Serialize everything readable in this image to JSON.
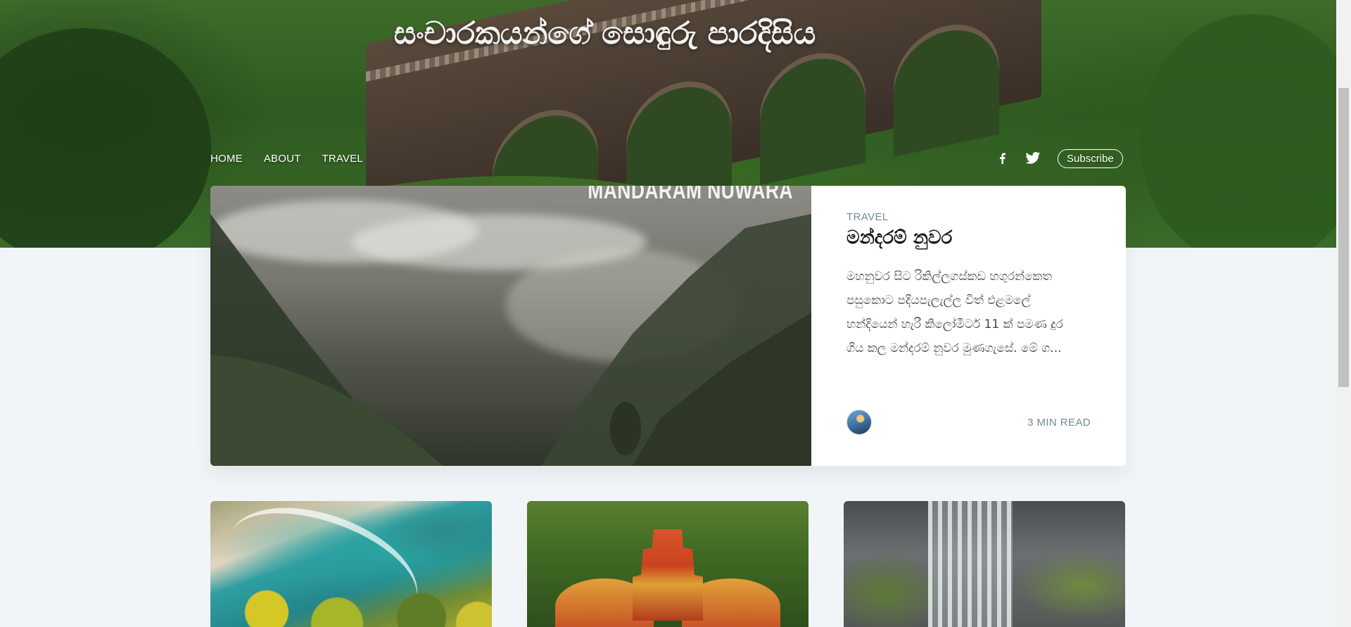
{
  "hero": {
    "title": "සංචාරකයන්ගේ සොඳුරු පාරදිසිය"
  },
  "nav": {
    "items": [
      {
        "label": "HOME"
      },
      {
        "label": "ABOUT"
      },
      {
        "label": "TRAVEL"
      }
    ],
    "social": [
      "facebook-icon",
      "twitter-icon"
    ],
    "subscribe_label": "Subscribe"
  },
  "featured": {
    "image_text": "MANDARAM NUWARA",
    "tag": "TRAVEL",
    "title": "මන්දරම් නුවර",
    "excerpt": "මහනුවර සිට රිකිල්ලගස්කඩ හගුරන්කෙත පසුකොට පදියපැලැල්ල විත් එළමලේ හන්දියෙන් හැරී කිලෝමීටර් 11 ක් පමණ දුර ගිය කල මන්දරම් නුවර මුණගැසේ. මේ ග...",
    "read_time": "3 MIN READ"
  },
  "colors": {
    "page_bg": "#f1f5f8",
    "tag": "#738a94",
    "title": "#15171a",
    "text": "#3c484e"
  }
}
